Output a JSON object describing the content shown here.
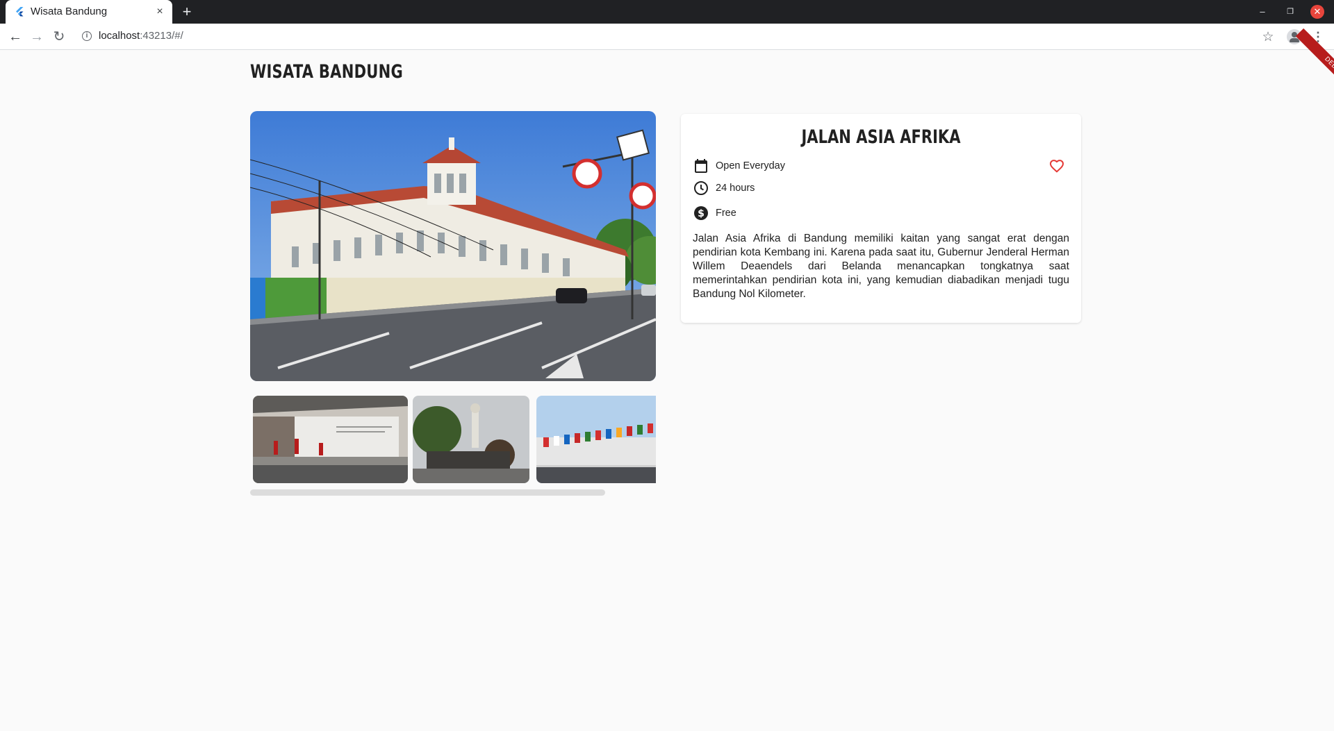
{
  "browser": {
    "tab_title": "Wisata Bandung",
    "tab_close": "×",
    "new_tab": "+",
    "url_host": "localhost",
    "url_rest": ":43213/#/",
    "window_controls": {
      "minimize": "–",
      "maximize": "❐",
      "close": "✕"
    }
  },
  "debug_banner": "DEBUG",
  "page": {
    "title": "WISATA BANDUNG",
    "main_image": "jalan-asia-afrika-gedung-merdeka-photo",
    "thumbnails": [
      "museum-konferensi-asia-afrika-interior",
      "asia-afrika-monument-globe",
      "flags-of-asia-afrika-nations"
    ],
    "scroll_fraction": 0.875
  },
  "detail": {
    "name": "JALAN ASIA AFRIKA",
    "open_days": "Open Everyday",
    "open_hours": "24 hours",
    "ticket_price": "Free",
    "favorite": false,
    "description": "Jalan Asia Afrika di Bandung memiliki kaitan yang sangat erat dengan pendirian kota Kembang ini. Karena pada saat itu, Gubernur Jenderal Herman Willem Deaendels dari Belanda menancapkan tongkatnya saat memerintahkan pendirian kota ini, yang kemudian diabadikan menjadi tugu Bandung Nol Kilometer."
  },
  "colors": {
    "background": "#fafafa",
    "favorite_red": "#e53935",
    "scroll_thumb": "#dcdcdc",
    "debug_red": "#b71c1c"
  }
}
